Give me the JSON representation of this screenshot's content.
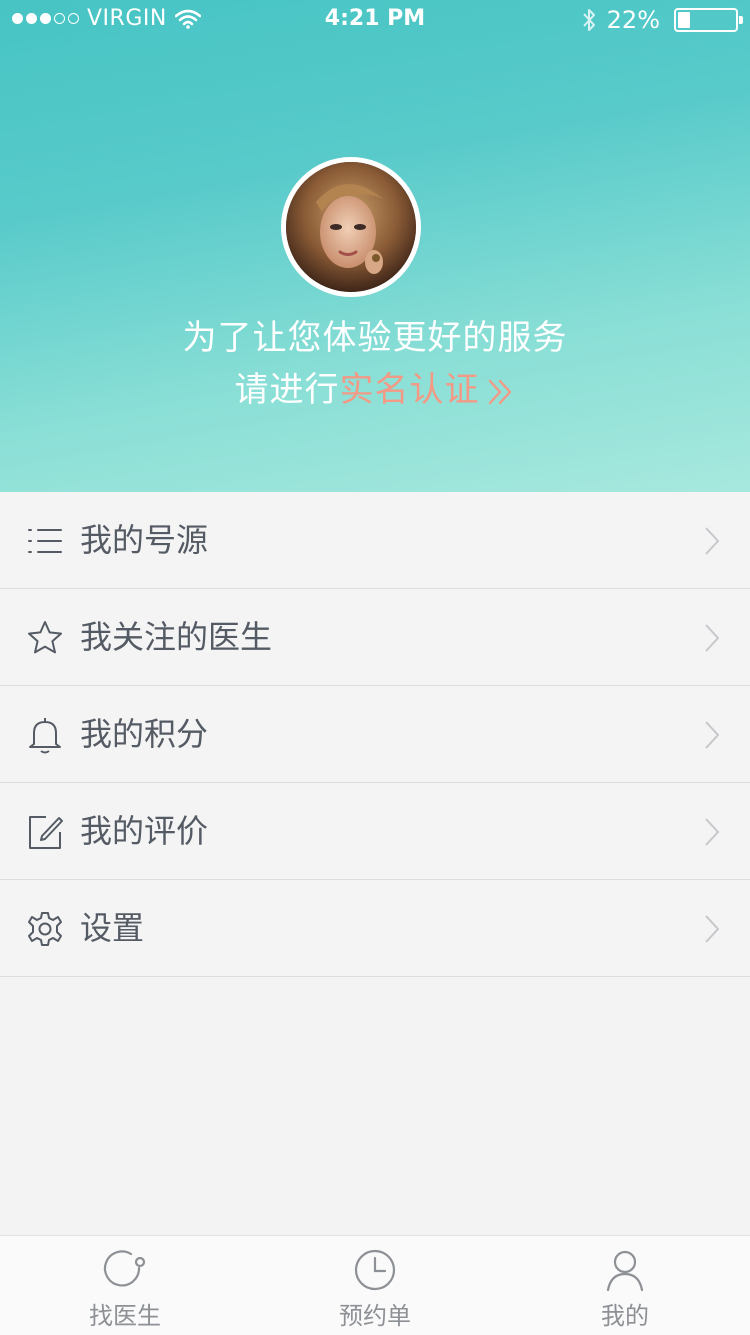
{
  "status_bar": {
    "carrier": "VIRGIN",
    "time": "4:21 PM",
    "battery": "22%",
    "battery_level": 0.22,
    "signal_strength": 3,
    "signal_max": 5
  },
  "profile": {
    "line1": "为了让您体验更好的服务",
    "line2_prefix": "请进行",
    "line2_link": "实名认证",
    "link_color": "#f39a86"
  },
  "menu": {
    "items": [
      {
        "label": "我的号源",
        "icon": "list-icon"
      },
      {
        "label": "我关注的医生",
        "icon": "star-icon"
      },
      {
        "label": "我的积分",
        "icon": "bell-icon"
      },
      {
        "label": "我的评价",
        "icon": "edit-icon"
      },
      {
        "label": "设置",
        "icon": "gear-icon"
      }
    ]
  },
  "tabs": [
    {
      "label": "找医生",
      "icon": "find-doctor-icon"
    },
    {
      "label": "预约单",
      "icon": "clock-icon"
    },
    {
      "label": "我的",
      "icon": "user-icon"
    }
  ],
  "colors": {
    "header_top": "#47c4c4",
    "header_bottom": "#a7e8de",
    "menu_bg": "#f4f4f4",
    "menu_text": "#555b64",
    "tab_text": "#8d9095"
  }
}
